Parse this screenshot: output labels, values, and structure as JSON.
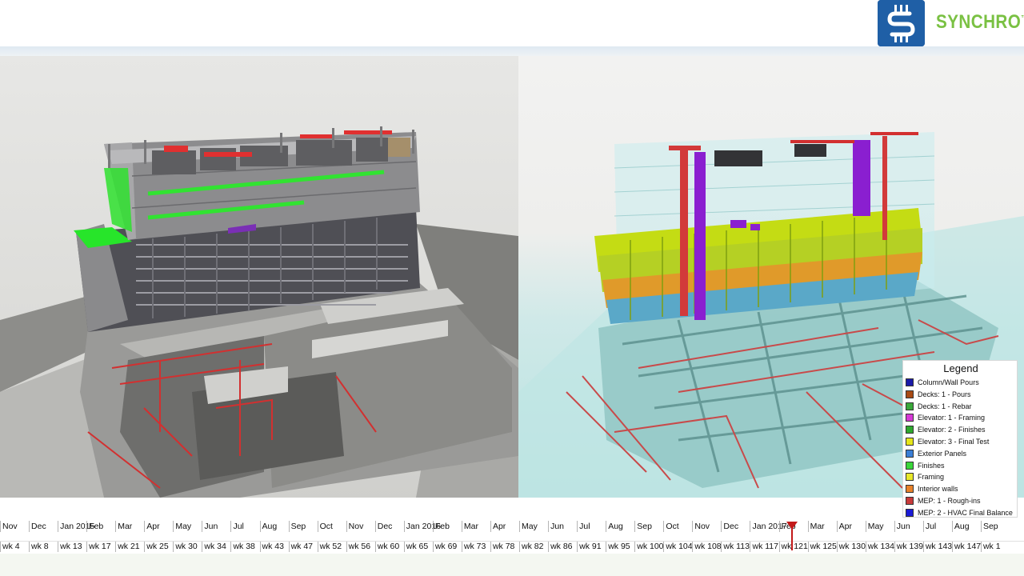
{
  "brand": {
    "name": "SYNCHRO",
    "trademark": "™",
    "mark_color": "#1f5fa6",
    "text_color": "#7ac143"
  },
  "viewports": [
    {
      "name": "realistic-4d-view"
    },
    {
      "name": "xray-4d-view"
    }
  ],
  "legend": {
    "title": "Legend",
    "items": [
      {
        "label": "Column/Wall Pours",
        "color": "#1a1aa8"
      },
      {
        "label": "Decks: 1 - Pours",
        "color": "#a84a14"
      },
      {
        "label": "Decks: 1 - Rebar",
        "color": "#3aa83a"
      },
      {
        "label": "Elevator: 1 - Framing",
        "color": "#d63ad6"
      },
      {
        "label": "Elevator: 2 - Finishes",
        "color": "#2ea82e"
      },
      {
        "label": "Elevator: 3 - Final Test",
        "color": "#e6e61a"
      },
      {
        "label": "Exterior Panels",
        "color": "#3a7ed6"
      },
      {
        "label": "Finishes",
        "color": "#3ad63a"
      },
      {
        "label": "Framing",
        "color": "#e8e82a"
      },
      {
        "label": "Interior walls",
        "color": "#e8822a"
      },
      {
        "label": "MEP: 1 - Rough-ins",
        "color": "#c83a3a"
      },
      {
        "label": "MEP: 2 - HVAC Final Balance",
        "color": "#1a1ad6"
      }
    ]
  },
  "timeline": {
    "months": [
      "Nov",
      "Dec",
      "Jan 2015",
      "Feb",
      "Mar",
      "Apr",
      "May",
      "Jun",
      "Jul",
      "Aug",
      "Sep",
      "Oct",
      "Nov",
      "Dec",
      "Jan 2016",
      "Feb",
      "Mar",
      "Apr",
      "May",
      "Jun",
      "Jul",
      "Aug",
      "Sep",
      "Oct",
      "Nov",
      "Dec",
      "Jan 2017",
      "Feb",
      "Mar",
      "Apr",
      "May",
      "Jun",
      "Jul",
      "Aug",
      "Sep"
    ],
    "weeks": [
      "wk 4",
      "wk 8",
      "wk 13",
      "wk 17",
      "wk 21",
      "wk 25",
      "wk 30",
      "wk 34",
      "wk 38",
      "wk 43",
      "wk 47",
      "wk 52",
      "wk 56",
      "wk 60",
      "wk 65",
      "wk 69",
      "wk 73",
      "wk 78",
      "wk 82",
      "wk 86",
      "wk 91",
      "wk 95",
      "wk 100",
      "wk 104",
      "wk 108",
      "wk 113",
      "wk 117",
      "wk 121",
      "wk 125",
      "wk 130",
      "wk 134",
      "wk 139",
      "wk 143",
      "wk 147",
      "wk 1"
    ],
    "current_marker_color": "#c31a1a"
  }
}
